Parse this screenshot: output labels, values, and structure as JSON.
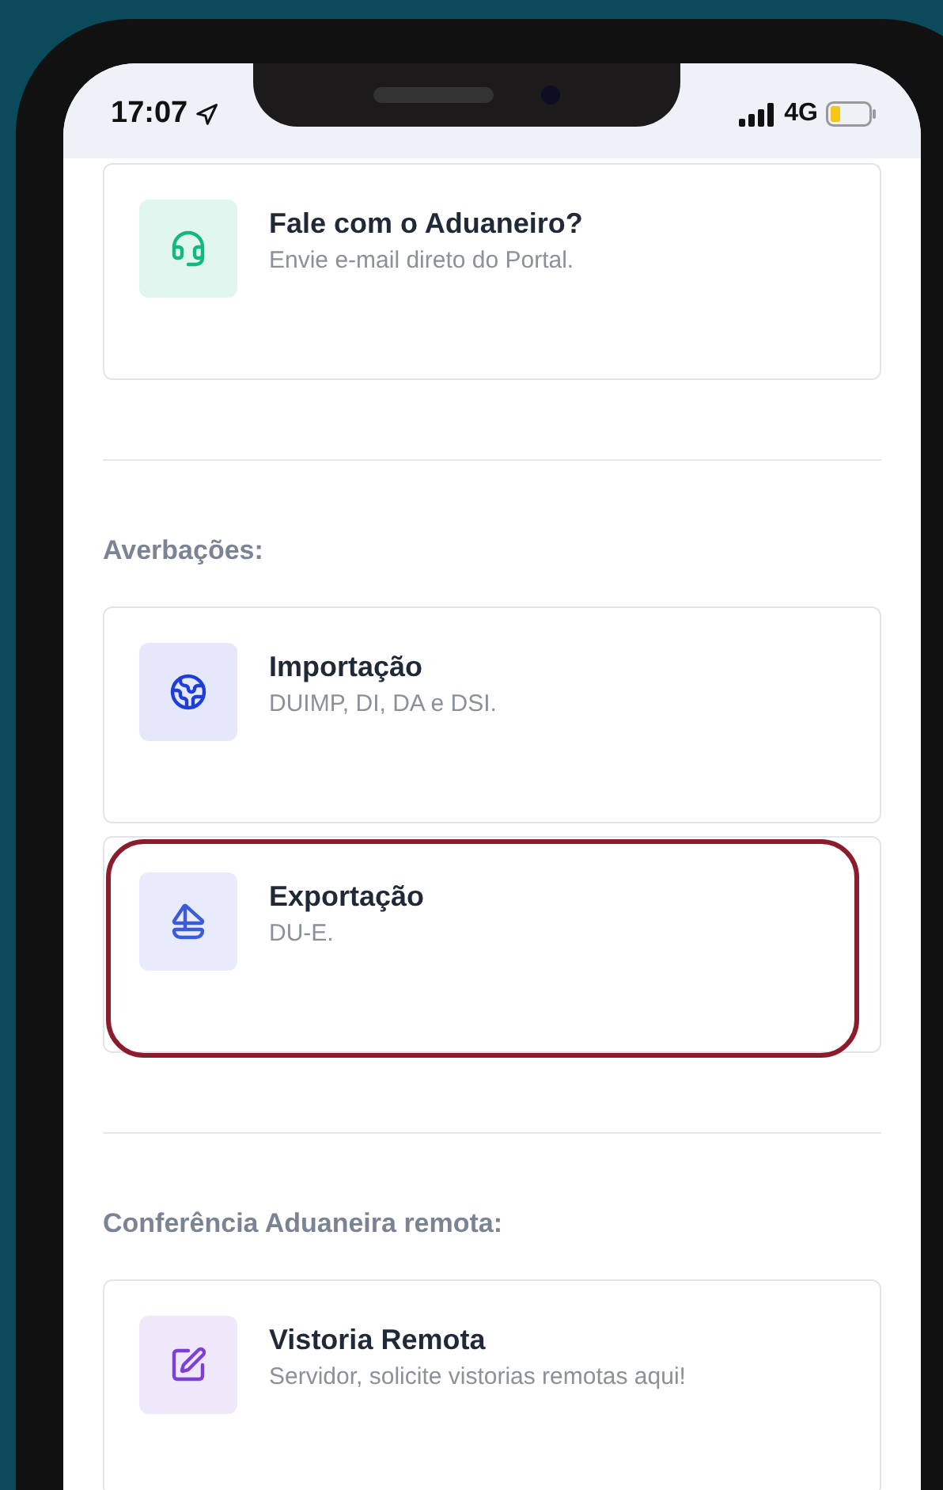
{
  "status_bar": {
    "time": "17:07",
    "network": "4G"
  },
  "sections": [
    {
      "items": [
        {
          "title": "Fale com o Aduaneiro?",
          "subtitle": "Envie e-mail direto do Portal.",
          "color": "#10b981",
          "highlighted": false
        }
      ]
    },
    {
      "title": "Averbações:",
      "items": [
        {
          "title": "Importação",
          "subtitle": "DUIMP, DI, DA e DSI.",
          "color": "#1d3ed8",
          "highlighted": false
        },
        {
          "title": "Exportação",
          "subtitle": "DU-E.",
          "color": "#3b5bdb",
          "highlighted": true
        }
      ]
    },
    {
      "title": "Conferência Aduaneira remota:",
      "items": [
        {
          "title": "Vistoria Remota",
          "subtitle": "Servidor, solicite vistorias remotas aqui!",
          "color": "#7e3fd6",
          "highlighted": false
        }
      ]
    }
  ]
}
